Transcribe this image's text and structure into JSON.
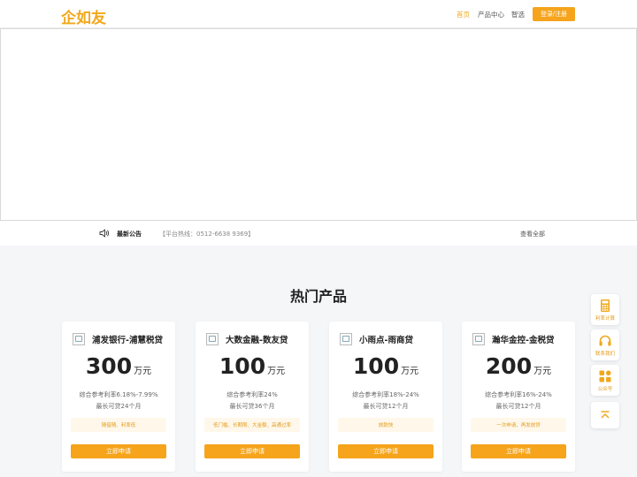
{
  "header": {
    "logo": "企如友",
    "nav": [
      {
        "label": "首页",
        "active": true
      },
      {
        "label": "产品中心",
        "active": false
      },
      {
        "label": "智选",
        "active": false
      }
    ],
    "login_label": "登录/注册"
  },
  "notice": {
    "title": "最新公告",
    "text": "【平台热线：0512-6638 9369】",
    "view_all": "查看全部"
  },
  "section": {
    "title": "热门产品"
  },
  "products": [
    {
      "name": "浦发银行-浦慧税贷",
      "amount": "300",
      "unit": "万元",
      "rate": "综合参考利率6.18%-7.99%",
      "term": "最长可贷24个月",
      "tags": "随借随、利率低",
      "apply": "立即申请"
    },
    {
      "name": "大数金融-数友贷",
      "amount": "100",
      "unit": "万元",
      "rate": "综合参考利率24%",
      "term": "最长可贷36个月",
      "tags": "低门槛、长期限、大金额、高通过率",
      "apply": "立即申请"
    },
    {
      "name": "小雨点-雨商贷",
      "amount": "100",
      "unit": "万元",
      "rate": "综合参考利率18%-24%",
      "term": "最长可贷12个月",
      "tags": "放款快",
      "apply": "立即申请"
    },
    {
      "name": "瀚华金控-金税贷",
      "amount": "200",
      "unit": "万元",
      "rate": "综合参考利率16%-24%",
      "term": "最长可贷12个月",
      "tags": "一次申请，再发放贷",
      "apply": "立即申请"
    }
  ],
  "float_bar": [
    {
      "label": "利率计算",
      "icon": "calculator-icon"
    },
    {
      "label": "联系我们",
      "icon": "headset-icon"
    },
    {
      "label": "公众号",
      "icon": "grid-icon"
    },
    {
      "label": "",
      "icon": "back-to-top-icon"
    }
  ],
  "colors": {
    "accent": "#f5a41c",
    "tag_bg": "#fff8ea",
    "tag_text": "#e39a1a"
  }
}
